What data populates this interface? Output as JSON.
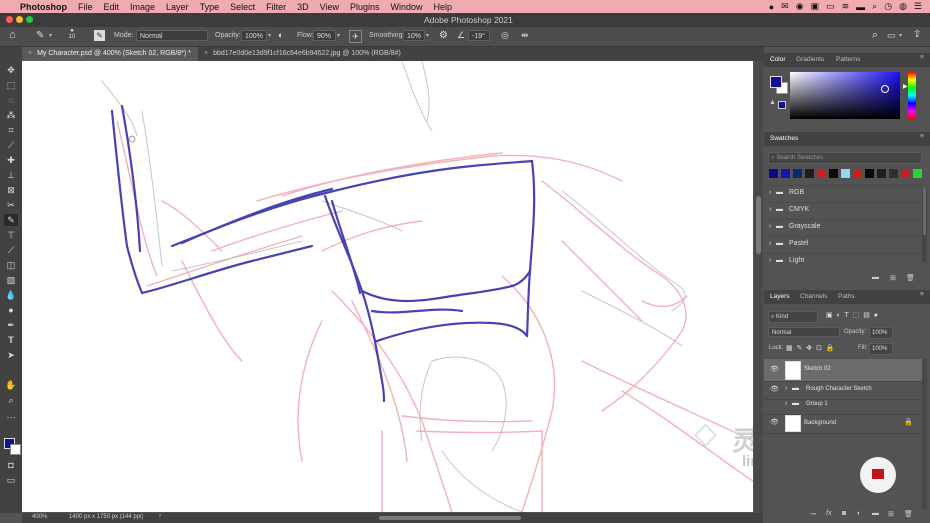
{
  "menubar": {
    "app_name": "Photoshop",
    "items": [
      "File",
      "Edit",
      "Image",
      "Layer",
      "Type",
      "Select",
      "Filter",
      "3D",
      "View",
      "Plugins",
      "Window",
      "Help"
    ]
  },
  "window": {
    "title": "Adobe Photoshop 2021"
  },
  "options": {
    "brush_size": "10",
    "mode_label": "Mode:",
    "mode_value": "Normal",
    "opacity_label": "Opacity:",
    "opacity_value": "100%",
    "flow_label": "Flow:",
    "flow_value": "90%",
    "smoothing_label": "Smoothing:",
    "smoothing_value": "10%",
    "angle_value": "-19°"
  },
  "tabs": [
    {
      "label": "My Character.psd @ 400% (Sketch 02, RGB/8*) *"
    },
    {
      "label": "bbd17e0d0e13d9f1cf16c64e6b94622.jpg @ 100% (RGB/8#)"
    }
  ],
  "status": {
    "zoom": "400%",
    "doc_info": "1400 px x 1750 px (144 ppi)"
  },
  "color_panel": {
    "tabs": [
      "Color",
      "Gradients",
      "Patterns"
    ],
    "foreground": "#10109a",
    "background": "#ffffff"
  },
  "swatches_panel": {
    "title": "Swatches",
    "search_placeholder": "Search Swatches",
    "colors": [
      "#0a0a8a",
      "#1414b4",
      "#0a2878",
      "#1e1e1e",
      "#d21e1e",
      "#0a0a0a",
      "#9ad2f0",
      "#c81e1e",
      "#0a0a0a",
      "#202020",
      "#303030",
      "#c81e1e",
      "#2ad23c"
    ],
    "folders": [
      "RGB",
      "CMYK",
      "Grayscale",
      "Pastel",
      "Light"
    ]
  },
  "layers_panel": {
    "tabs": [
      "Layers",
      "Channels",
      "Paths"
    ],
    "filter": "Kind",
    "blend_mode": "Normal",
    "opacity_label": "Opacity:",
    "opacity_value": "100%",
    "lock_label": "Lock:",
    "fill_label": "Fill:",
    "fill_value": "100%",
    "layers": [
      {
        "name": "Sketch 02"
      },
      {
        "name": "Rough Character Sketch"
      },
      {
        "name": "Group 1"
      },
      {
        "name": "Background"
      }
    ]
  },
  "watermark": {
    "cn": "灵感中国",
    "url": "lingganchina.com"
  }
}
